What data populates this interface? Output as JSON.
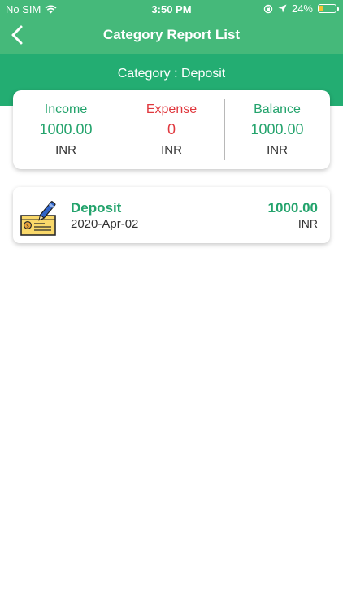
{
  "status_bar": {
    "carrier": "No SIM",
    "time": "3:50 PM",
    "battery": "24%",
    "battery_level": 0.24,
    "icons": [
      "wifi-icon",
      "orientation-lock-icon",
      "location-arrow-icon",
      "battery-icon"
    ]
  },
  "nav": {
    "title": "Category Report List",
    "back_icon": "back-chevron-icon"
  },
  "category": {
    "label": "Category : Deposit"
  },
  "summary": {
    "income": {
      "label": "Income",
      "value": "1000.00",
      "unit": "INR"
    },
    "expense": {
      "label": "Expense",
      "value": "0",
      "unit": "INR"
    },
    "balance": {
      "label": "Balance",
      "value": "1000.00",
      "unit": "INR"
    }
  },
  "entries": [
    {
      "title": "Deposit",
      "date": "2020-Apr-02",
      "amount": "1000.00",
      "currency": "INR",
      "icon": "cheque-icon"
    }
  ],
  "colors": {
    "header_green": "#23ad72",
    "navbar_green": "#45b97a",
    "text_green": "#23a36c",
    "expense_red": "#e0383e"
  }
}
